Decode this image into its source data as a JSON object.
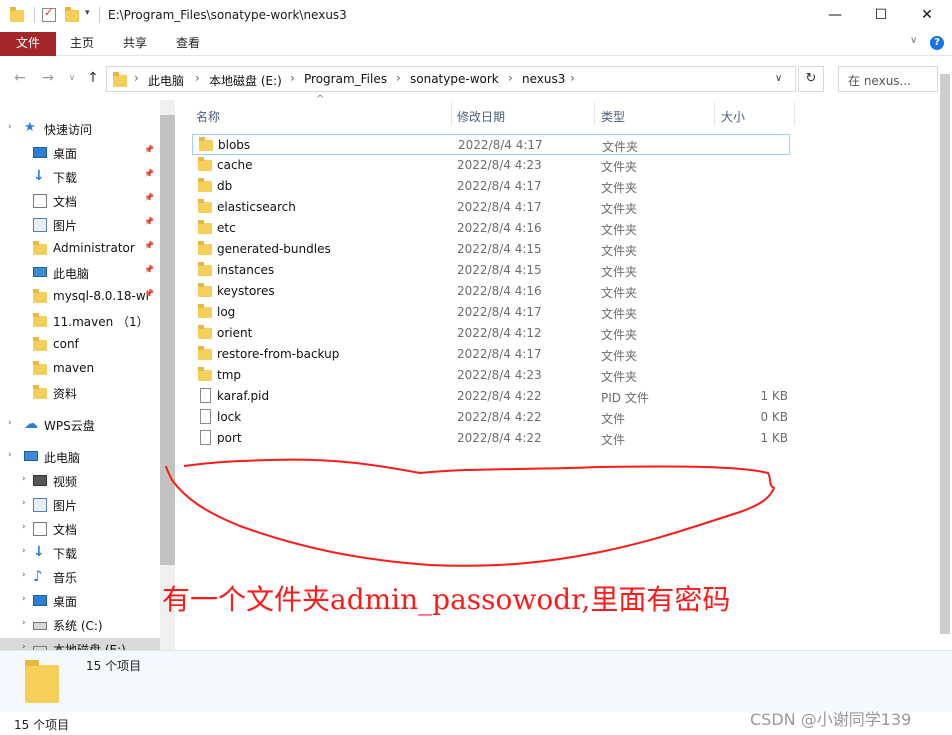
{
  "window": {
    "title": "E:\\Program_Files\\sonatype-work\\nexus3",
    "minimize": "—",
    "maximize": "☐",
    "close": "✕"
  },
  "ribbon": {
    "file_tab": "文件",
    "tabs": [
      "主页",
      "共享",
      "查看"
    ]
  },
  "address": {
    "crumbs": [
      "此电脑",
      "本地磁盘 (E:)",
      "Program_Files",
      "sonatype-work",
      "nexus3"
    ],
    "search_placeholder": "在 nexus..."
  },
  "sidebar": {
    "quick_access": "快速访问",
    "quick_items": [
      {
        "label": "桌面",
        "icon": "desktop-icon",
        "pinned": true
      },
      {
        "label": "下载",
        "icon": "download-icon",
        "pinned": true
      },
      {
        "label": "文档",
        "icon": "document-icon",
        "pinned": true
      },
      {
        "label": "图片",
        "icon": "picture-icon",
        "pinned": true
      },
      {
        "label": "Administrator",
        "icon": "folder-icon",
        "pinned": true
      },
      {
        "label": "此电脑",
        "icon": "pc-icon",
        "pinned": true
      },
      {
        "label": "mysql-8.0.18-wi",
        "icon": "folder-icon",
        "pinned": true
      },
      {
        "label": "11.maven （1）",
        "icon": "folder-icon",
        "pinned": false
      },
      {
        "label": "conf",
        "icon": "folder-icon",
        "pinned": false
      },
      {
        "label": "maven",
        "icon": "folder-icon",
        "pinned": false
      },
      {
        "label": "资料",
        "icon": "folder-icon",
        "pinned": false
      }
    ],
    "wps_cloud": "WPS云盘",
    "this_pc": "此电脑",
    "pc_items": [
      {
        "label": "视频",
        "icon": "video-icon"
      },
      {
        "label": "图片",
        "icon": "picture-icon"
      },
      {
        "label": "文档",
        "icon": "document-icon"
      },
      {
        "label": "下载",
        "icon": "download-icon"
      },
      {
        "label": "音乐",
        "icon": "music-icon"
      },
      {
        "label": "桌面",
        "icon": "desktop-icon"
      },
      {
        "label": "系统 (C:)",
        "icon": "drive-icon"
      },
      {
        "label": "本地磁盘 (E:)",
        "icon": "drive-icon"
      }
    ]
  },
  "columns": {
    "name": "名称",
    "date": "修改日期",
    "type": "类型",
    "size": "大小"
  },
  "files": [
    {
      "name": "blobs",
      "date": "2022/8/4 4:17",
      "type": "文件夹",
      "size": "",
      "kind": "folder"
    },
    {
      "name": "cache",
      "date": "2022/8/4 4:23",
      "type": "文件夹",
      "size": "",
      "kind": "folder"
    },
    {
      "name": "db",
      "date": "2022/8/4 4:17",
      "type": "文件夹",
      "size": "",
      "kind": "folder"
    },
    {
      "name": "elasticsearch",
      "date": "2022/8/4 4:17",
      "type": "文件夹",
      "size": "",
      "kind": "folder"
    },
    {
      "name": "etc",
      "date": "2022/8/4 4:16",
      "type": "文件夹",
      "size": "",
      "kind": "folder"
    },
    {
      "name": "generated-bundles",
      "date": "2022/8/4 4:15",
      "type": "文件夹",
      "size": "",
      "kind": "folder"
    },
    {
      "name": "instances",
      "date": "2022/8/4 4:15",
      "type": "文件夹",
      "size": "",
      "kind": "folder"
    },
    {
      "name": "keystores",
      "date": "2022/8/4 4:16",
      "type": "文件夹",
      "size": "",
      "kind": "folder"
    },
    {
      "name": "log",
      "date": "2022/8/4 4:17",
      "type": "文件夹",
      "size": "",
      "kind": "folder"
    },
    {
      "name": "orient",
      "date": "2022/8/4 4:12",
      "type": "文件夹",
      "size": "",
      "kind": "folder"
    },
    {
      "name": "restore-from-backup",
      "date": "2022/8/4 4:17",
      "type": "文件夹",
      "size": "",
      "kind": "folder"
    },
    {
      "name": "tmp",
      "date": "2022/8/4 4:23",
      "type": "文件夹",
      "size": "",
      "kind": "folder"
    },
    {
      "name": "karaf.pid",
      "date": "2022/8/4 4:22",
      "type": "PID 文件",
      "size": "1 KB",
      "kind": "file"
    },
    {
      "name": "lock",
      "date": "2022/8/4 4:22",
      "type": "文件",
      "size": "0 KB",
      "kind": "file"
    },
    {
      "name": "port",
      "date": "2022/8/4 4:22",
      "type": "文件",
      "size": "1 KB",
      "kind": "file"
    }
  ],
  "details_pane": {
    "count": "15 个项目"
  },
  "status_bar": {
    "count": "15 个项目"
  },
  "annotation": {
    "text": "有一个文件夹admin_passowodr,里面有密码",
    "color": "#ff1a1a"
  },
  "watermark": "CSDN @小谢同学139",
  "colors": {
    "file_tab": "#a3262a",
    "folder": "#f6cf5a",
    "accent": "#2a7fd4",
    "selection_border": "#99d1ff"
  }
}
